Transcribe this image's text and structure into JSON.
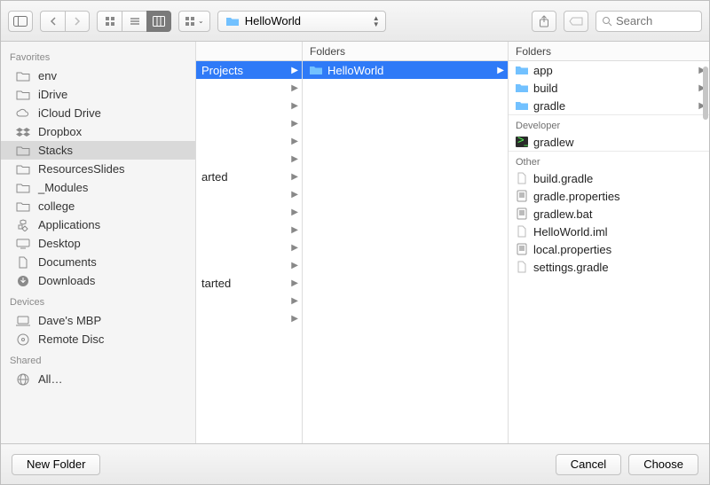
{
  "toolbar": {
    "path_label": "HelloWorld",
    "search_placeholder": "Search"
  },
  "sidebar": {
    "sections": [
      {
        "title": "Favorites",
        "items": [
          {
            "label": "env",
            "icon": "folder"
          },
          {
            "label": "iDrive",
            "icon": "folder"
          },
          {
            "label": "iCloud Drive",
            "icon": "cloud"
          },
          {
            "label": "Dropbox",
            "icon": "dropbox"
          },
          {
            "label": "Stacks",
            "icon": "folder",
            "selected": true
          },
          {
            "label": "ResourcesSlides",
            "icon": "folder"
          },
          {
            "label": "_Modules",
            "icon": "folder"
          },
          {
            "label": "college",
            "icon": "folder"
          },
          {
            "label": "Applications",
            "icon": "apps"
          },
          {
            "label": "Desktop",
            "icon": "desktop"
          },
          {
            "label": "Documents",
            "icon": "doc"
          },
          {
            "label": "Downloads",
            "icon": "download"
          }
        ]
      },
      {
        "title": "Devices",
        "items": [
          {
            "label": "Dave's MBP",
            "icon": "laptop"
          },
          {
            "label": "Remote Disc",
            "icon": "disc"
          }
        ]
      },
      {
        "title": "Shared",
        "items": [
          {
            "label": "All…",
            "icon": "globe"
          }
        ]
      }
    ]
  },
  "columns": {
    "col1": {
      "header": "",
      "items": [
        {
          "label": "Projects",
          "folder": true,
          "selected": true
        },
        {
          "label": "",
          "folder": true
        },
        {
          "label": "",
          "folder": true
        },
        {
          "label": "",
          "folder": true
        },
        {
          "label": "",
          "folder": true
        },
        {
          "label": "",
          "folder": true
        },
        {
          "label": "arted",
          "folder": true
        },
        {
          "label": "",
          "folder": true
        },
        {
          "label": "",
          "folder": true
        },
        {
          "label": "",
          "folder": true
        },
        {
          "label": "",
          "folder": true
        },
        {
          "label": "",
          "folder": true
        },
        {
          "label": "tarted",
          "folder": true
        },
        {
          "label": "",
          "folder": true
        },
        {
          "label": "",
          "folder": true
        }
      ]
    },
    "col2": {
      "header": "Folders",
      "items": [
        {
          "label": "HelloWorld",
          "folder": true,
          "selected": true
        }
      ]
    },
    "col3": {
      "header": "Folders",
      "groups": [
        {
          "title": null,
          "items": [
            {
              "label": "app",
              "icon": "folder-blue",
              "arrow": true
            },
            {
              "label": "build",
              "icon": "folder-blue",
              "arrow": true
            },
            {
              "label": "gradle",
              "icon": "folder-blue",
              "arrow": true
            }
          ]
        },
        {
          "title": "Developer",
          "items": [
            {
              "label": "gradlew",
              "icon": "exec"
            }
          ]
        },
        {
          "title": "Other",
          "items": [
            {
              "label": "build.gradle",
              "icon": "file"
            },
            {
              "label": "gradle.properties",
              "icon": "prop"
            },
            {
              "label": "gradlew.bat",
              "icon": "prop"
            },
            {
              "label": "HelloWorld.iml",
              "icon": "file"
            },
            {
              "label": "local.properties",
              "icon": "prop"
            },
            {
              "label": "settings.gradle",
              "icon": "file"
            }
          ]
        }
      ]
    }
  },
  "footer": {
    "new_folder": "New Folder",
    "cancel": "Cancel",
    "choose": "Choose"
  }
}
